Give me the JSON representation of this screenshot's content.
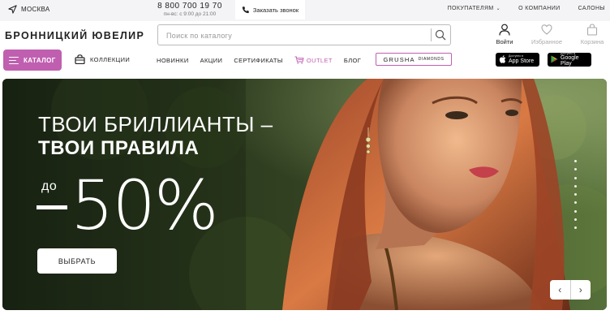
{
  "topbar": {
    "city": "МОСКВА",
    "phone": "8 800 700 19 70",
    "hours": "пн-вс: с 9:00 до 21:00",
    "callback": "Заказать звонок",
    "links": [
      "ПОКУПАТЕЛЯМ",
      "О КОМПАНИИ",
      "САЛОНЫ"
    ]
  },
  "header": {
    "logo": "БРОННИЦКИЙ ЮВЕЛИР",
    "search_placeholder": "Поиск по каталогу",
    "login": "Войти",
    "favorites": "Избранное",
    "cart": "Корзина"
  },
  "nav": {
    "catalog": "КАТАЛОГ",
    "collections": "КОЛЛЕКЦИИ",
    "items": [
      "НОВИНКИ",
      "АКЦИИ",
      "СЕРТИФИКАТЫ"
    ],
    "outlet": "OUTLET",
    "blog": "БЛОГ",
    "grusha": "GRUSHA",
    "grusha_sub": "DIAMONDS",
    "appstore_small": "Доступно в",
    "appstore": "App Store",
    "googleplay_small": "Доступно в",
    "googleplay": "Google Play"
  },
  "hero": {
    "line1": "ТВОИ БРИЛЛИАНТЫ –",
    "line2": "ТВОИ ПРАВИЛА",
    "upto": "до",
    "discount": "50%",
    "button": "ВЫБРАТЬ",
    "slide_count": 9,
    "prev": "‹",
    "next": "›"
  },
  "colors": {
    "accent": "#c05fb0",
    "topbar_bg": "#f4f4f6"
  }
}
